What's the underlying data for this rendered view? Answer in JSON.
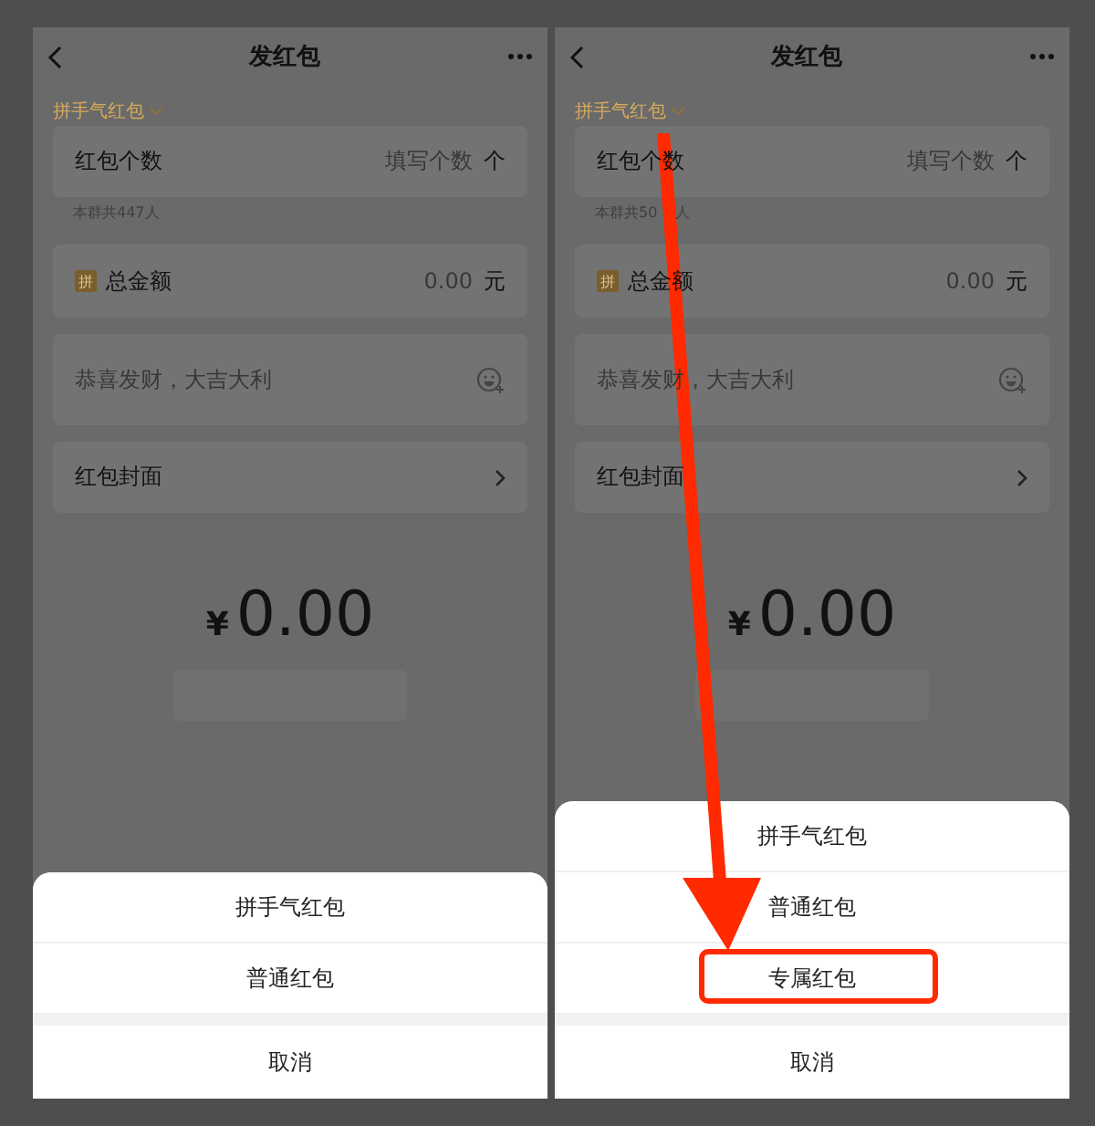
{
  "panels": [
    {
      "nav": {
        "title": "发红包"
      },
      "type_selector": "拼手气红包",
      "count_row": {
        "label": "红包个数",
        "placeholder": "填写个数",
        "unit": "个"
      },
      "hint": [
        "本群共447人"
      ],
      "amount_row": {
        "badge": "拼",
        "label": "总金额",
        "placeholder": "0.00",
        "unit": "元"
      },
      "greeting": {
        "placeholder": "恭喜发财，大吉大利"
      },
      "cover_row": {
        "label": "红包封面"
      },
      "total": {
        "currency": "¥",
        "amount": "0.00"
      },
      "arrow": false,
      "sheet": {
        "options": [
          {
            "label": "拼手气红包",
            "highlighted": false
          },
          {
            "label": "普通红包",
            "highlighted": false
          }
        ],
        "cancel": "取消"
      }
    },
    {
      "nav": {
        "title": "发红包"
      },
      "type_selector": "拼手气红包",
      "count_row": {
        "label": "红包个数",
        "placeholder": "填写个数",
        "unit": "个"
      },
      "hint": [
        "本群共50",
        "人"
      ],
      "amount_row": {
        "badge": "拼",
        "label": "总金额",
        "placeholder": "0.00",
        "unit": "元"
      },
      "greeting": {
        "placeholder": "恭喜发财，大吉大利"
      },
      "cover_row": {
        "label": "红包封面"
      },
      "total": {
        "currency": "¥",
        "amount": "0.00"
      },
      "arrow": true,
      "sheet": {
        "options": [
          {
            "label": "拼手气红包",
            "highlighted": false
          },
          {
            "label": "普通红包",
            "highlighted": false
          },
          {
            "label": "专属红包",
            "highlighted": true
          }
        ],
        "cancel": "取消"
      }
    }
  ]
}
